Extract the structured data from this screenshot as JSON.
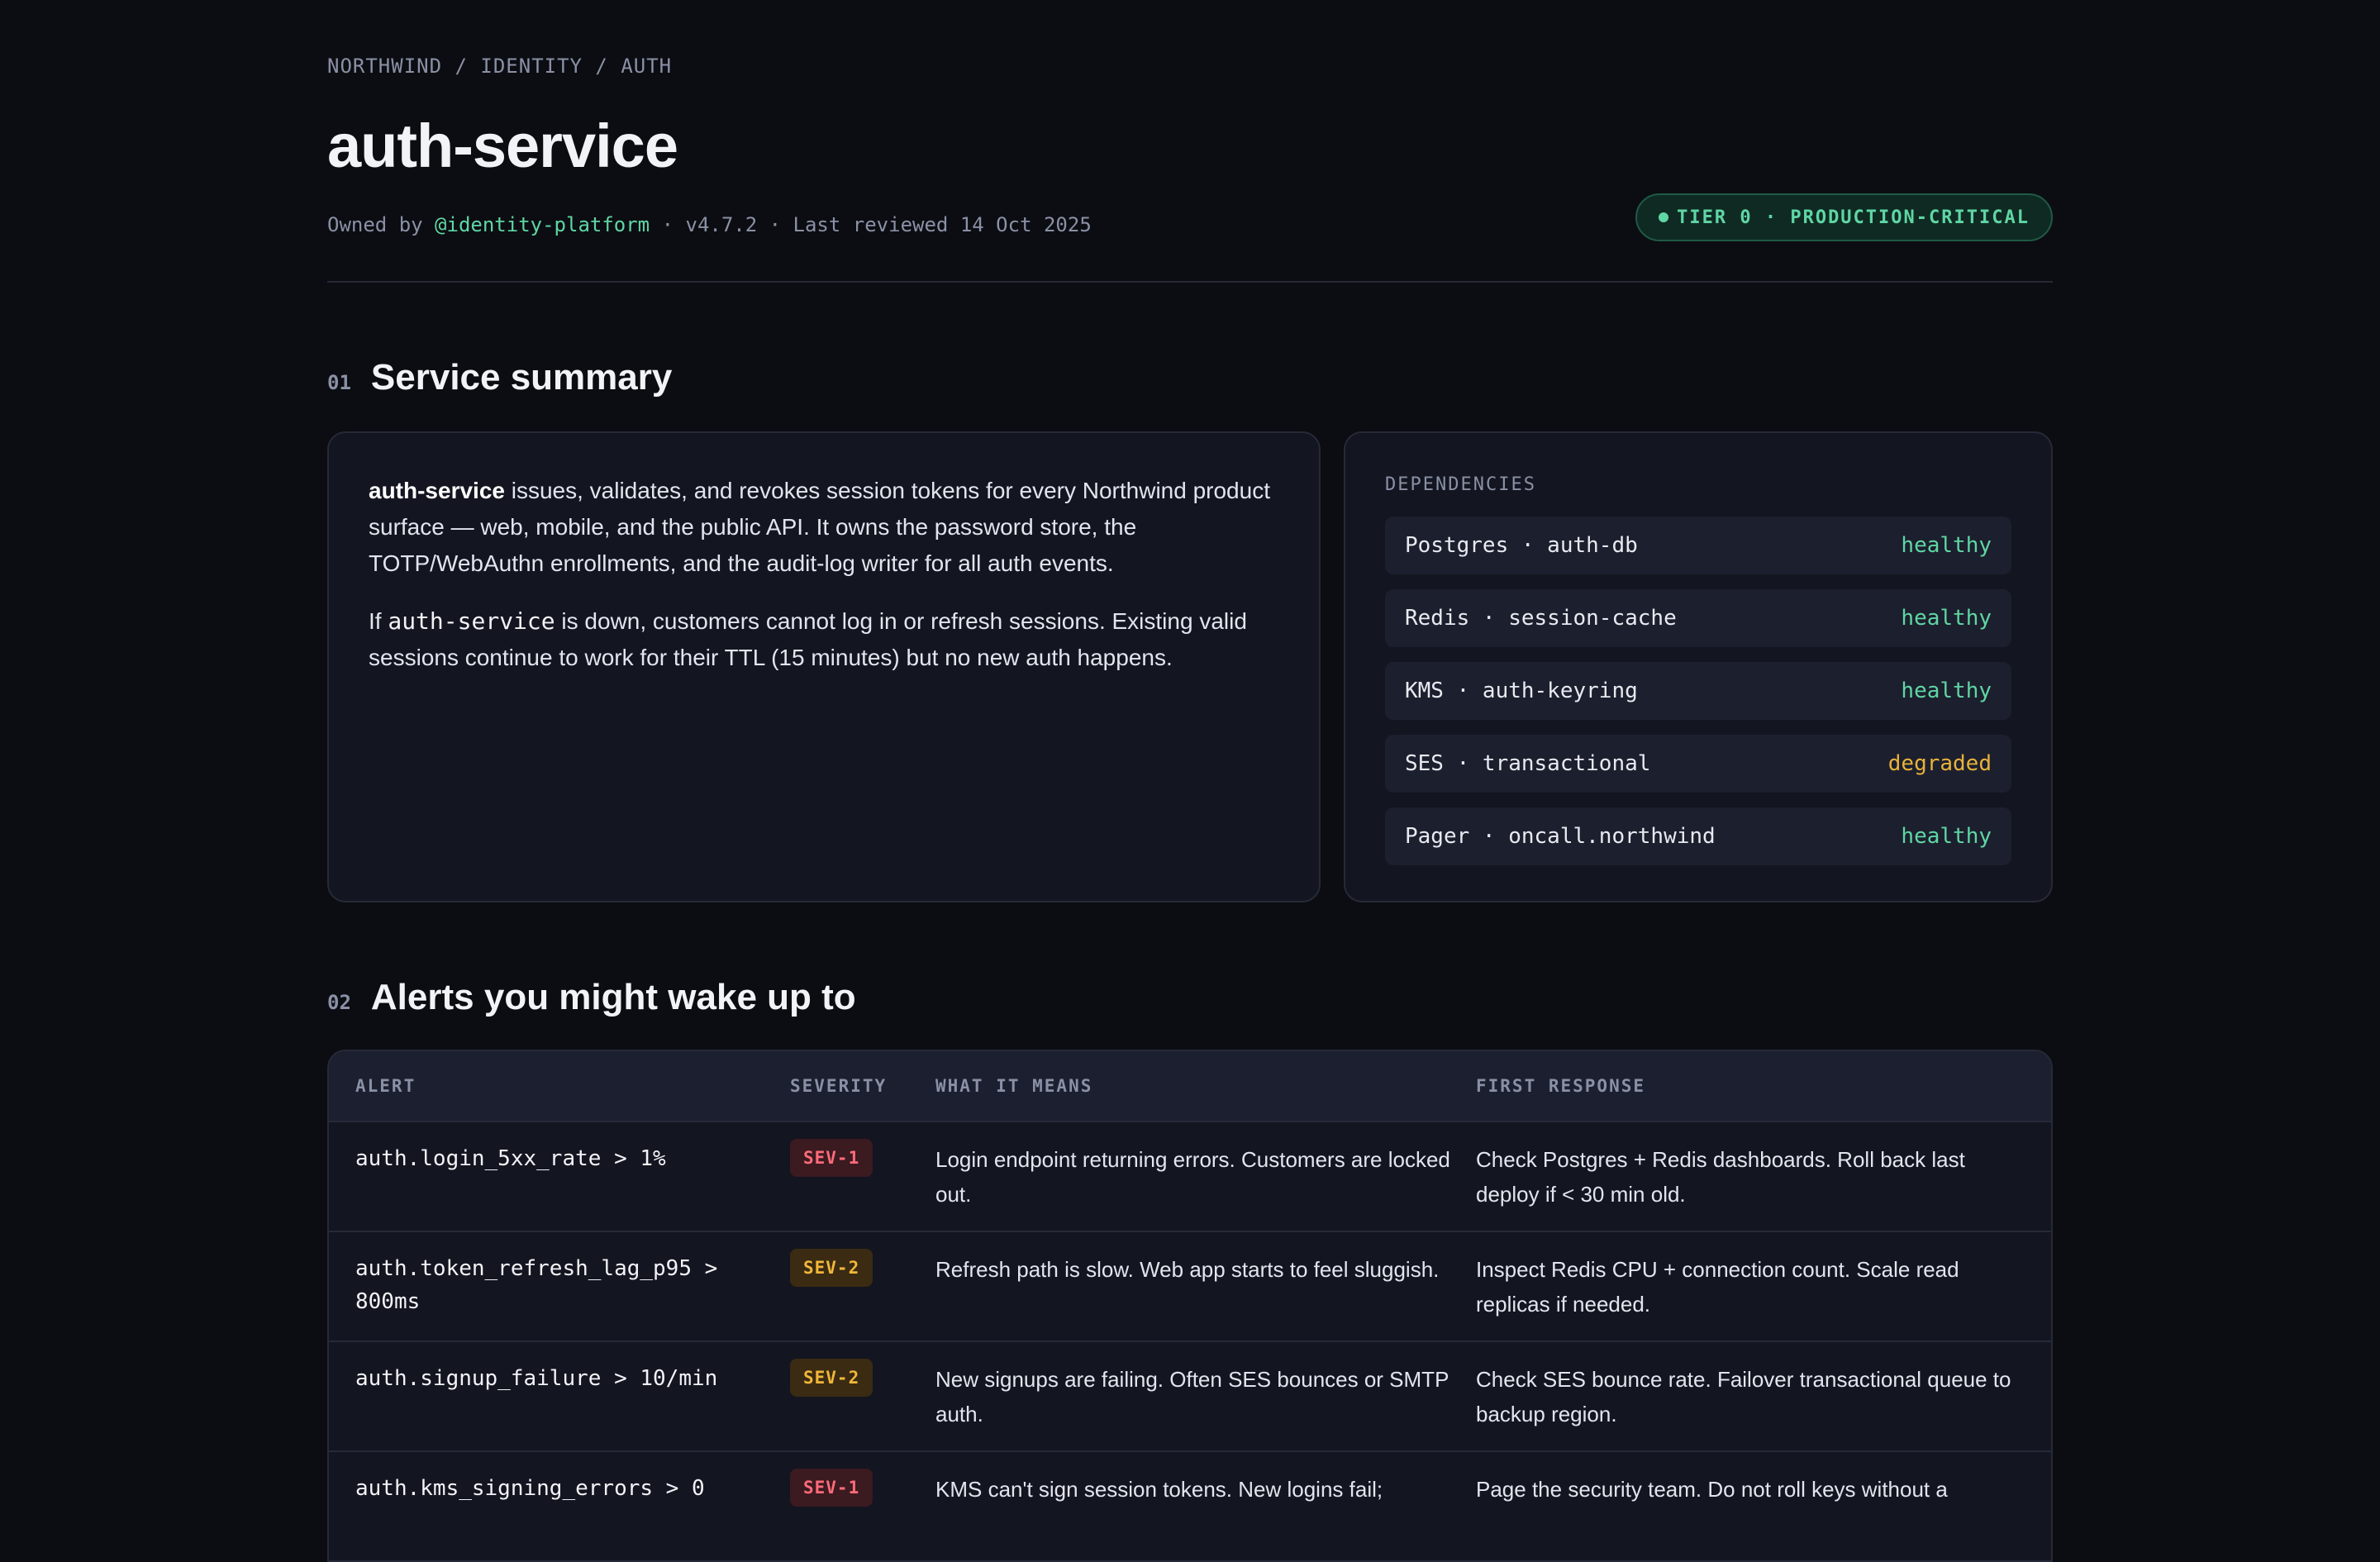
{
  "breadcrumb": "NORTHWIND / IDENTITY / AUTH",
  "title": "auth-service",
  "meta": {
    "owned_by_label": "Owned by ",
    "owner": "@identity-platform",
    "rest": " · v4.7.2 · Last reviewed 14 Oct 2025"
  },
  "tier_badge": "TIER 0 · PRODUCTION-CRITICAL",
  "sections": {
    "summary": {
      "num": "01",
      "title": "Service summary"
    },
    "alerts": {
      "num": "02",
      "title": "Alerts you might wake up to"
    }
  },
  "summary": {
    "p1_strong": "auth-service",
    "p1_rest": " issues, validates, and revokes session tokens for every Northwind product surface — web, mobile, and the public API. It owns the password store, the TOTP/WebAuthn enrollments, and the audit-log writer for all auth events.",
    "p2_pre": "If ",
    "p2_code": "auth-service",
    "p2_rest": " is down, customers cannot log in or refresh sessions. Existing valid sessions continue to work for their TTL (15 minutes) but no new auth happens."
  },
  "dependencies": {
    "label": "DEPENDENCIES",
    "items": [
      {
        "name": "Postgres · auth-db",
        "status": "healthy"
      },
      {
        "name": "Redis · session-cache",
        "status": "healthy"
      },
      {
        "name": "KMS · auth-keyring",
        "status": "healthy"
      },
      {
        "name": "SES · transactional",
        "status": "degraded"
      },
      {
        "name": "Pager · oncall.northwind",
        "status": "healthy"
      }
    ]
  },
  "alerts": {
    "headers": [
      "ALERT",
      "SEVERITY",
      "WHAT IT MEANS",
      "FIRST RESPONSE"
    ],
    "rows": [
      {
        "alert": "auth.login_5xx_rate > 1%",
        "severity": "SEV-1",
        "means": "Login endpoint returning errors. Customers are locked out.",
        "first": "Check Postgres + Redis dashboards. Roll back last deploy if < 30 min old."
      },
      {
        "alert": "auth.token_refresh_lag_p95 > 800ms",
        "severity": "SEV-2",
        "means": "Refresh path is slow. Web app starts to feel sluggish.",
        "first": "Inspect Redis CPU + connection count. Scale read replicas if needed."
      },
      {
        "alert": "auth.signup_failure > 10/min",
        "severity": "SEV-2",
        "means": "New signups are failing. Often SES bounces or SMTP auth.",
        "first": "Check SES bounce rate. Failover transactional queue to backup region."
      },
      {
        "alert": "auth.kms_signing_errors > 0",
        "severity": "SEV-1",
        "means": "KMS can't sign session tokens. New logins fail;",
        "first": "Page the security team. Do not roll keys without a"
      }
    ]
  },
  "colors": {
    "background": "#0c0d12",
    "accent_green": "#5fd6a4",
    "degraded_amber": "#e8b23a",
    "sev1_red": "#ff6b7a",
    "sev2_amber": "#f2b73a"
  }
}
